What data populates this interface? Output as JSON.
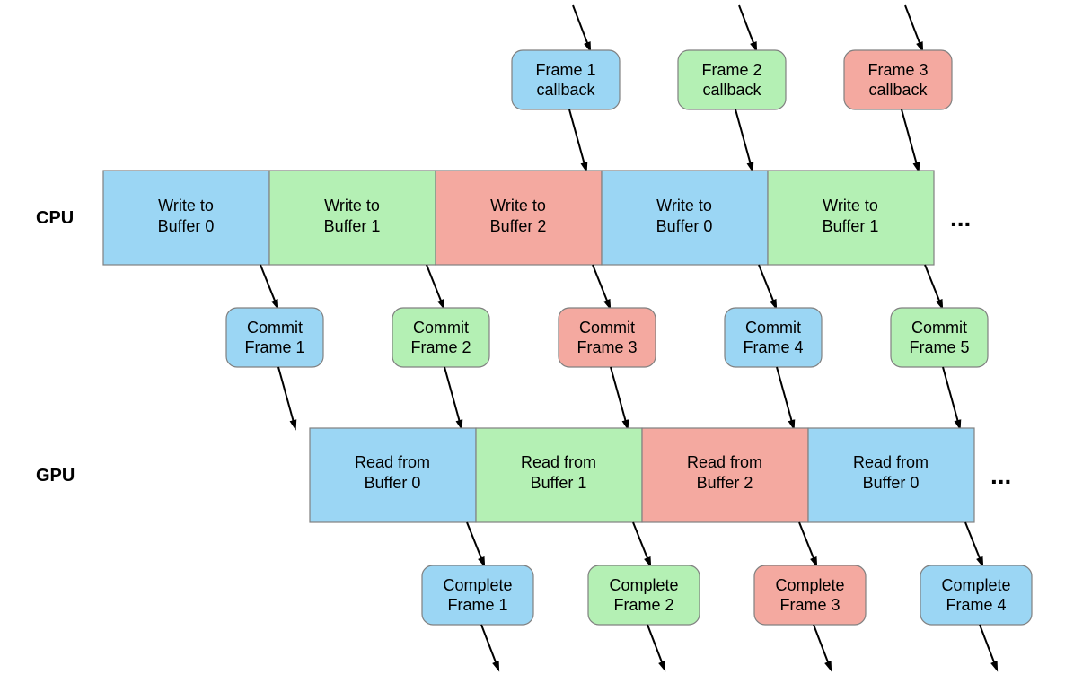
{
  "colors": {
    "blue": "#9bd6f4",
    "green": "#b4f0b4",
    "red": "#f4a9a0",
    "border": "#808080"
  },
  "labels": {
    "cpu": "CPU",
    "gpu": "GPU",
    "dots": "..."
  },
  "callback_boxes": [
    {
      "color": "blue",
      "line1": "Frame 1",
      "line2": "callback"
    },
    {
      "color": "green",
      "line1": "Frame 2",
      "line2": "callback"
    },
    {
      "color": "red",
      "line1": "Frame 3",
      "line2": "callback"
    }
  ],
  "cpu_row": [
    {
      "color": "blue",
      "line1": "Write to",
      "line2": "Buffer 0"
    },
    {
      "color": "green",
      "line1": "Write to",
      "line2": "Buffer 1"
    },
    {
      "color": "red",
      "line1": "Write to",
      "line2": "Buffer 2"
    },
    {
      "color": "blue",
      "line1": "Write to",
      "line2": "Buffer 0"
    },
    {
      "color": "green",
      "line1": "Write to",
      "line2": "Buffer 1"
    }
  ],
  "commit_boxes": [
    {
      "color": "blue",
      "line1": "Commit",
      "line2": "Frame 1"
    },
    {
      "color": "green",
      "line1": "Commit",
      "line2": "Frame 2"
    },
    {
      "color": "red",
      "line1": "Commit",
      "line2": "Frame 3"
    },
    {
      "color": "blue",
      "line1": "Commit",
      "line2": "Frame 4"
    },
    {
      "color": "green",
      "line1": "Commit",
      "line2": "Frame 5"
    }
  ],
  "gpu_row": [
    {
      "color": "blue",
      "line1": "Read from",
      "line2": "Buffer 0"
    },
    {
      "color": "green",
      "line1": "Read from",
      "line2": "Buffer 1"
    },
    {
      "color": "red",
      "line1": "Read from",
      "line2": "Buffer 2"
    },
    {
      "color": "blue",
      "line1": "Read from",
      "line2": "Buffer 0"
    }
  ],
  "complete_boxes": [
    {
      "color": "blue",
      "line1": "Complete",
      "line2": "Frame 1"
    },
    {
      "color": "green",
      "line1": "Complete",
      "line2": "Frame 2"
    },
    {
      "color": "red",
      "line1": "Complete",
      "line2": "Frame 3"
    },
    {
      "color": "blue",
      "line1": "Complete",
      "line2": "Frame 4"
    }
  ]
}
